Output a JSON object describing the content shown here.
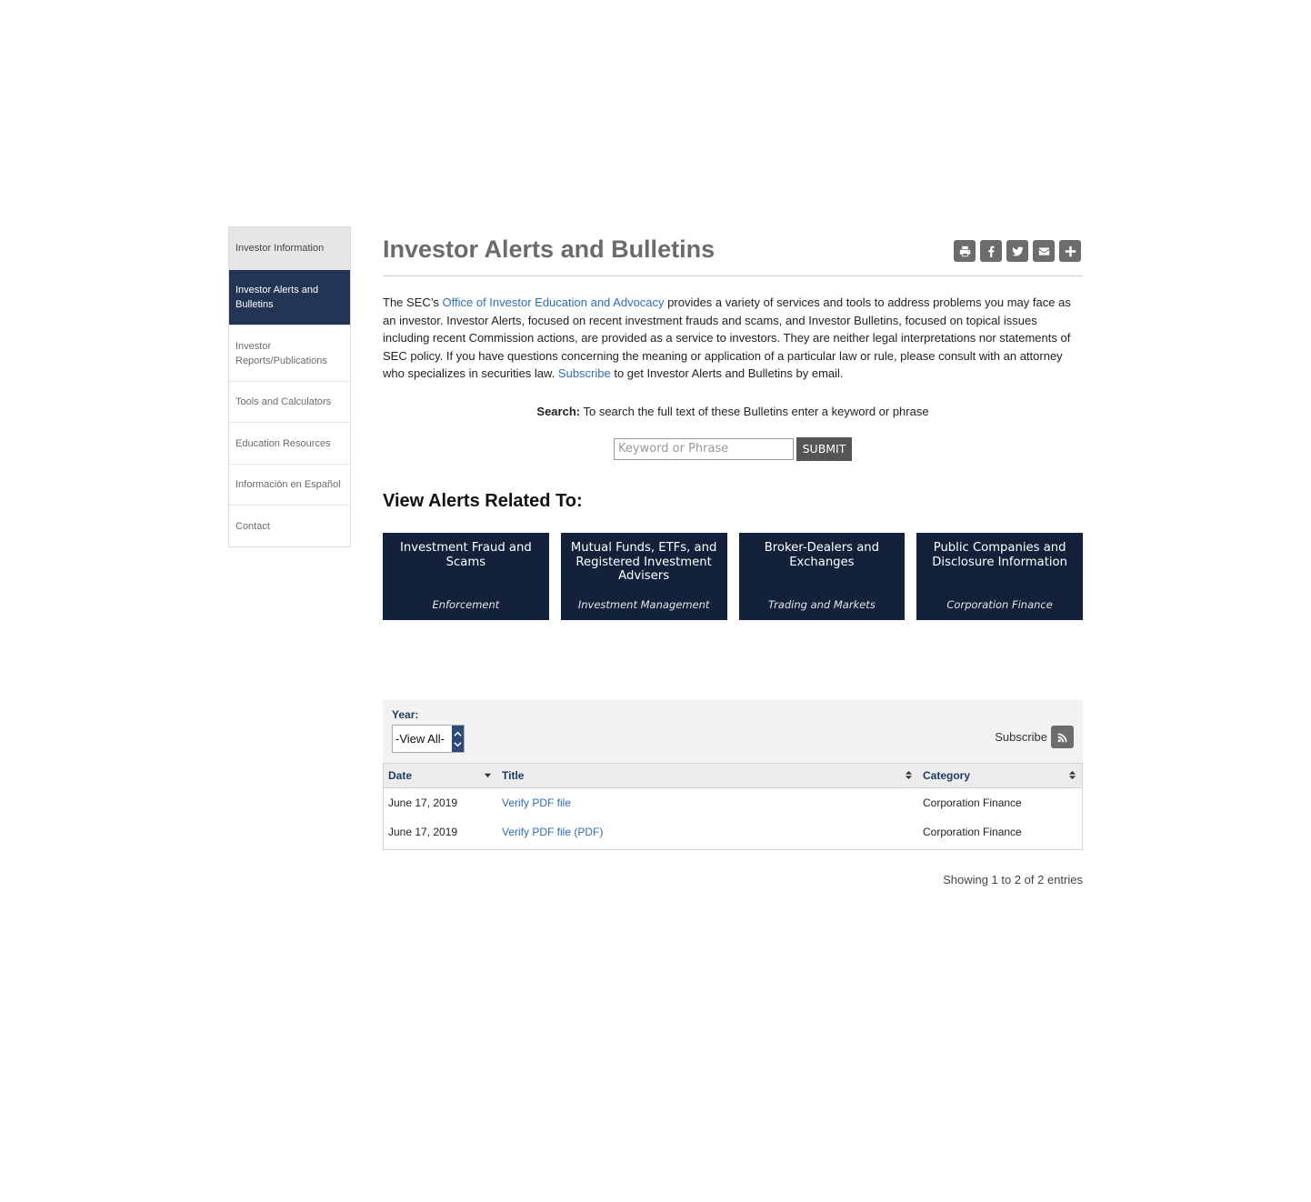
{
  "sidebar": {
    "items": [
      {
        "label": "Investor Information"
      },
      {
        "label": "Investor Alerts and Bulletins"
      },
      {
        "label": "Investor Reports/Publications"
      },
      {
        "label": "Tools and Calculators"
      },
      {
        "label": "Education Resources"
      },
      {
        "label": "Información en Español"
      },
      {
        "label": "Contact"
      }
    ]
  },
  "header": {
    "title": "Investor Alerts and Bulletins",
    "share_icons": [
      "print-icon",
      "facebook-icon",
      "twitter-icon",
      "email-icon",
      "plus-icon"
    ]
  },
  "intro": {
    "text_before_link": "The SEC’s ",
    "link_office": "Office of Investor Education and Advocacy",
    "text_middle": " provides a variety of services and tools to address problems you may face as an investor. Investor Alerts, focused on recent investment frauds and scams, and Investor Bulletins, focused on topical issues including recent Commission actions, are provided as a service to investors. They are neither legal interpretations nor statements of SEC policy. If you have questions concerning the meaning or application of a particular law or rule, please consult with an attorney who specializes in securities law. ",
    "link_subscribe": "Subscribe",
    "text_after_link": " to get Investor Alerts and Bulletins by email."
  },
  "search": {
    "label_bold": "Search:",
    "label_text": " To search the full text of these Bulletins enter a keyword or phrase",
    "placeholder": "Keyword or Phrase",
    "submit_label": "SUBMIT"
  },
  "related": {
    "heading": "View Alerts Related To:",
    "tiles": [
      {
        "title": "Investment Fraud and Scams",
        "subtitle": "Enforcement"
      },
      {
        "title": "Mutual Funds, ETFs, and Registered Investment Advisers",
        "subtitle": "Investment Management"
      },
      {
        "title": "Broker-Dealers and Exchanges",
        "subtitle": "Trading and Markets"
      },
      {
        "title": "Public Companies and Disclosure Information",
        "subtitle": "Corporation Finance"
      }
    ]
  },
  "filter": {
    "year_label": "Year:",
    "year_value": "-View All-",
    "subscribe_label": "Subscribe"
  },
  "table": {
    "headers": [
      "Date",
      "Title",
      "Category"
    ],
    "rows": [
      {
        "date": "June 17, 2019",
        "title": "Verify PDF file",
        "category": "Corporation Finance"
      },
      {
        "date": "June 17, 2019",
        "title": "Verify PDF file (PDF)",
        "category": "Corporation Finance"
      }
    ],
    "footer": "Showing 1 to 2 of 2 entries"
  },
  "colors": {
    "accent": "#223554",
    "tile_bg": "#13213a",
    "link": "#2f6eb5"
  }
}
